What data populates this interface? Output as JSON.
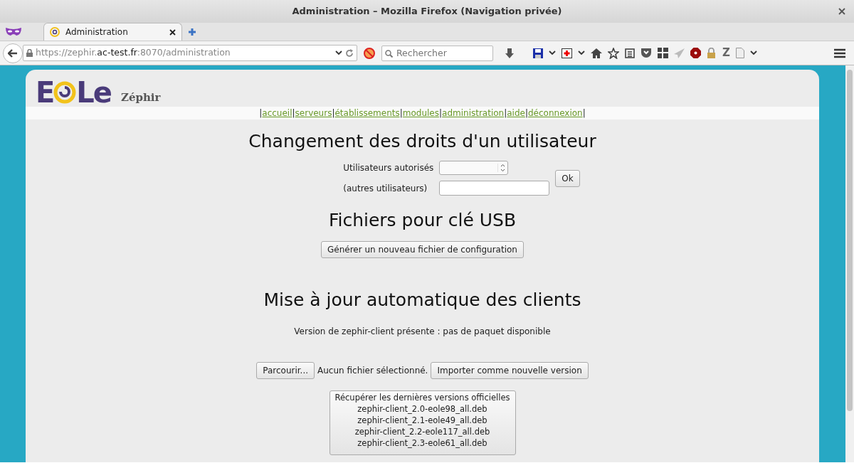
{
  "window": {
    "title": "Administration – Mozilla Firefox (Navigation privée)"
  },
  "tabs": [
    {
      "label": "Administration",
      "selected": true
    }
  ],
  "address_bar": {
    "url_prefix": "https://zephir.",
    "url_domain": "ac-test.fr",
    "url_suffix": ":8070/administration"
  },
  "search": {
    "placeholder": "Rechercher"
  },
  "toolbar_letter": "Z",
  "site": {
    "logo_start": "E",
    "logo_end": "Le",
    "title": "Zéphir"
  },
  "nav": {
    "separator": "|",
    "items": [
      "accueil",
      "serveurs",
      "établissements",
      "modules",
      "administration",
      "aide",
      "déconnexion"
    ]
  },
  "rights": {
    "heading": "Changement des droits d'un utilisateur",
    "users_label": "Utilisateurs autorisés",
    "others_label": "(autres utilisateurs)",
    "ok_button": "Ok"
  },
  "usb": {
    "heading": "Fichiers pour clé USB",
    "generate_button": "Générer un nouveau fichier de configuration"
  },
  "updates": {
    "heading": "Mise à jour automatique des clients",
    "version_text": "Version de zephir-client présente : pas de paquet disponible",
    "browse_button": "Parcourir...",
    "file_status": "Aucun fichier sélectionné.",
    "import_button": "Importer comme nouvelle version",
    "fetch_button": {
      "title": "Récupérer les dernières versions officielles",
      "files": [
        "zephir-client_2.0-eole98_all.deb",
        "zephir-client_2.1-eole49_all.deb",
        "zephir-client_2.2-eole117_all.deb",
        "zephir-client_2.3-eole61_all.deb"
      ]
    }
  }
}
